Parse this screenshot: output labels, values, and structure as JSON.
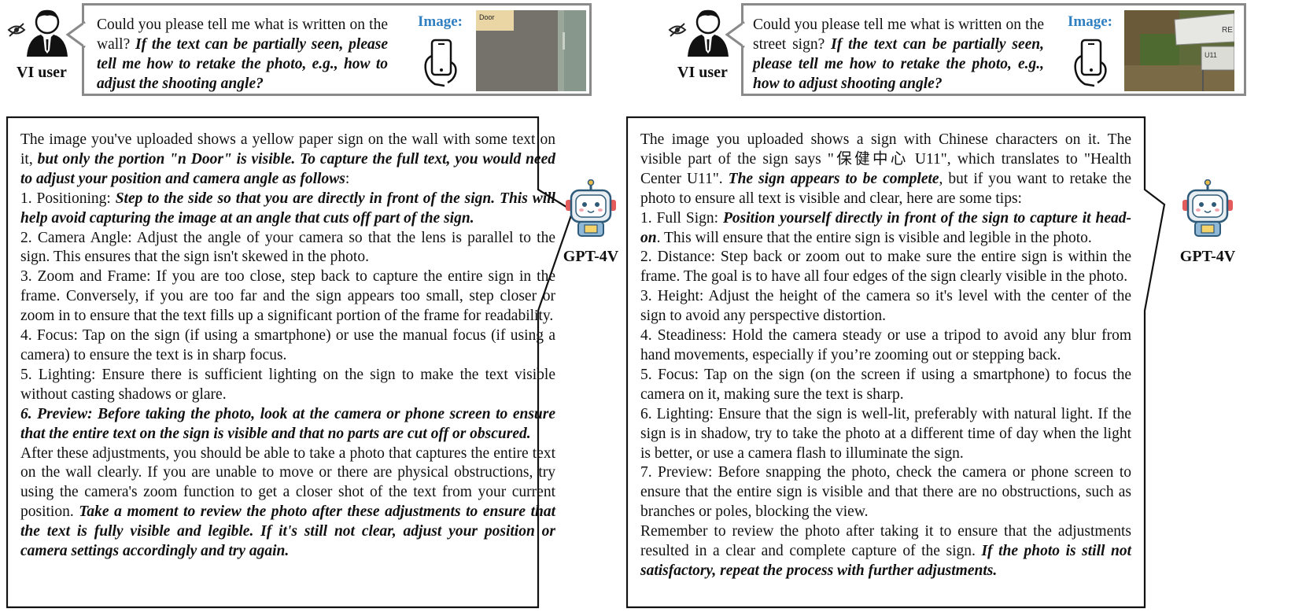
{
  "left": {
    "user_label": "VI user",
    "question_plain": "Could you please tell me what is written on the wall? ",
    "question_emph": "If the text can be partially seen, please tell me how to retake the photo, e.g., how to adjust the shooting angle?",
    "image_label": "Image:",
    "thumb_text": "Door",
    "bot_label": "GPT-4V",
    "answer": [
      {
        "segs": [
          {
            "t": "The image you've uploaded shows a yellow paper sign on the wall with some text on it, "
          },
          {
            "t": "but only the portion \"n Door\" is visible. To capture the full text, you would need to adjust your position and camera angle as follows",
            "e": true
          },
          {
            "t": ":"
          }
        ]
      },
      {
        "segs": [
          {
            "t": "1. Positioning: "
          },
          {
            "t": "Step to the side so that you are directly in front of the sign. This will help avoid capturing the image at an angle that cuts off part of the sign.",
            "e": true
          }
        ]
      },
      {
        "segs": [
          {
            "t": "2. Camera Angle: Adjust the angle of your camera so that the lens is parallel to the sign. This ensures that the sign isn't skewed in the photo."
          }
        ]
      },
      {
        "segs": [
          {
            "t": "3. Zoom and Frame: If you are too close, step back to capture the entire sign in the frame. Conversely, if you are too far and the sign appears too small, step closer or zoom in to ensure that the text fills up a significant portion of the frame for readability."
          }
        ]
      },
      {
        "segs": [
          {
            "t": "4. Focus: Tap on the sign (if using a smartphone) or use the manual focus (if using a camera) to ensure the text is in sharp focus."
          }
        ]
      },
      {
        "segs": [
          {
            "t": "5. Lighting: Ensure there is sufficient lighting on the sign to make the text visible without casting shadows or glare."
          }
        ]
      },
      {
        "segs": [
          {
            "t": "6. Preview: Before taking the photo, look at the camera or phone screen to ensure that the entire text on the sign is visible and that no parts are cut off or obscured.",
            "e": true
          }
        ]
      },
      {
        "segs": [
          {
            "t": "After these adjustments, you should be able to take a photo that captures the entire text on the wall clearly. If you are unable to move or there are physical obstructions, try using the camera's zoom function to get a closer shot of the text from your current position. "
          },
          {
            "t": "Take a moment to review the photo after these adjustments to ensure that the text is fully visible and legible. If it's still not clear, adjust your position or camera settings accordingly and try again.",
            "e": true
          }
        ]
      }
    ]
  },
  "right": {
    "user_label": "VI user",
    "question_plain": "Could you please tell me what is written on the street sign? ",
    "question_emph": "If the text can be partially seen, please tell me how to retake the photo, e.g., how to adjust shooting angle?",
    "image_label": "Image:",
    "thumb_text_1": "RE",
    "thumb_text_2": "U11",
    "bot_label": "GPT-4V",
    "answer": [
      {
        "segs": [
          {
            "t": "The image you uploaded shows a sign with Chinese characters on it. The visible part of the sign says \"保健中心 U11\", which translates to \"Health Center U11\". "
          },
          {
            "t": "The sign appears to be complete",
            "e": true
          },
          {
            "t": ", but if you want to retake the photo to ensure all text is visible and clear, here are some tips:"
          }
        ]
      },
      {
        "segs": [
          {
            "t": "1. Full Sign: "
          },
          {
            "t": "Position yourself directly in front of the sign to capture it head-on",
            "e": true
          },
          {
            "t": ". This will ensure that the entire sign is visible and legible in the photo."
          }
        ]
      },
      {
        "segs": [
          {
            "t": "2. Distance: Step back or zoom out to make sure the entire sign is within the frame. The goal is to have all four edges of the sign clearly visible in the photo."
          }
        ]
      },
      {
        "segs": [
          {
            "t": "3. Height: Adjust the height of the camera so it's level with the center of the sign to avoid any perspective distortion."
          }
        ]
      },
      {
        "segs": [
          {
            "t": "4. Steadiness: Hold the camera steady or use a tripod to avoid any blur from hand movements, especially if you’re zooming out or stepping back."
          }
        ]
      },
      {
        "segs": [
          {
            "t": "5. Focus: Tap on the sign (on the screen if using a smartphone) to focus the camera on it, making sure the text is sharp."
          }
        ]
      },
      {
        "segs": [
          {
            "t": "6. Lighting: Ensure that the sign is well-lit, preferably with natural light. If the sign is in shadow, try to take the photo at a different time of day when the light is better, or use a camera flash to illuminate the sign."
          }
        ]
      },
      {
        "segs": [
          {
            "t": "7. Preview: Before snapping the photo, check the camera or phone screen to ensure that the entire sign is visible and that there are no obstructions, such as branches or poles, blocking the view."
          }
        ]
      },
      {
        "segs": [
          {
            "t": "Remember to review the photo after taking it to ensure that the adjustments resulted in a clear and complete capture of the sign. "
          },
          {
            "t": "If the photo is still not satisfactory, repeat the process with further adjustments.",
            "e": true
          }
        ]
      }
    ]
  }
}
